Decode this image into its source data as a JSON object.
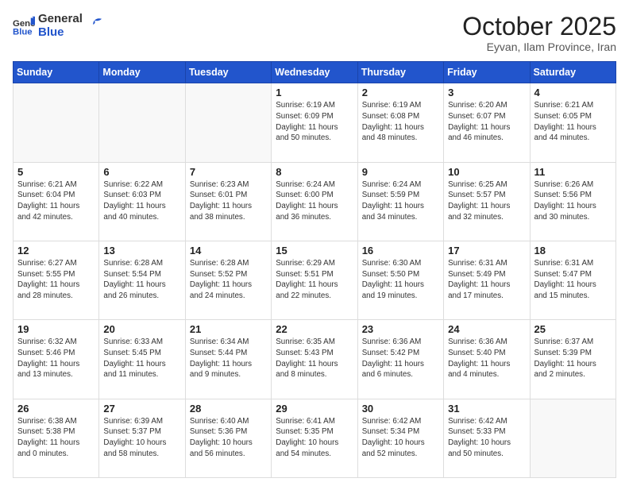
{
  "header": {
    "logo_general": "General",
    "logo_blue": "Blue",
    "month_title": "October 2025",
    "location": "Eyvan, Ilam Province, Iran"
  },
  "weekdays": [
    "Sunday",
    "Monday",
    "Tuesday",
    "Wednesday",
    "Thursday",
    "Friday",
    "Saturday"
  ],
  "weeks": [
    [
      {
        "day": "",
        "info": ""
      },
      {
        "day": "",
        "info": ""
      },
      {
        "day": "",
        "info": ""
      },
      {
        "day": "1",
        "info": "Sunrise: 6:19 AM\nSunset: 6:09 PM\nDaylight: 11 hours\nand 50 minutes."
      },
      {
        "day": "2",
        "info": "Sunrise: 6:19 AM\nSunset: 6:08 PM\nDaylight: 11 hours\nand 48 minutes."
      },
      {
        "day": "3",
        "info": "Sunrise: 6:20 AM\nSunset: 6:07 PM\nDaylight: 11 hours\nand 46 minutes."
      },
      {
        "day": "4",
        "info": "Sunrise: 6:21 AM\nSunset: 6:05 PM\nDaylight: 11 hours\nand 44 minutes."
      }
    ],
    [
      {
        "day": "5",
        "info": "Sunrise: 6:21 AM\nSunset: 6:04 PM\nDaylight: 11 hours\nand 42 minutes."
      },
      {
        "day": "6",
        "info": "Sunrise: 6:22 AM\nSunset: 6:03 PM\nDaylight: 11 hours\nand 40 minutes."
      },
      {
        "day": "7",
        "info": "Sunrise: 6:23 AM\nSunset: 6:01 PM\nDaylight: 11 hours\nand 38 minutes."
      },
      {
        "day": "8",
        "info": "Sunrise: 6:24 AM\nSunset: 6:00 PM\nDaylight: 11 hours\nand 36 minutes."
      },
      {
        "day": "9",
        "info": "Sunrise: 6:24 AM\nSunset: 5:59 PM\nDaylight: 11 hours\nand 34 minutes."
      },
      {
        "day": "10",
        "info": "Sunrise: 6:25 AM\nSunset: 5:57 PM\nDaylight: 11 hours\nand 32 minutes."
      },
      {
        "day": "11",
        "info": "Sunrise: 6:26 AM\nSunset: 5:56 PM\nDaylight: 11 hours\nand 30 minutes."
      }
    ],
    [
      {
        "day": "12",
        "info": "Sunrise: 6:27 AM\nSunset: 5:55 PM\nDaylight: 11 hours\nand 28 minutes."
      },
      {
        "day": "13",
        "info": "Sunrise: 6:28 AM\nSunset: 5:54 PM\nDaylight: 11 hours\nand 26 minutes."
      },
      {
        "day": "14",
        "info": "Sunrise: 6:28 AM\nSunset: 5:52 PM\nDaylight: 11 hours\nand 24 minutes."
      },
      {
        "day": "15",
        "info": "Sunrise: 6:29 AM\nSunset: 5:51 PM\nDaylight: 11 hours\nand 22 minutes."
      },
      {
        "day": "16",
        "info": "Sunrise: 6:30 AM\nSunset: 5:50 PM\nDaylight: 11 hours\nand 19 minutes."
      },
      {
        "day": "17",
        "info": "Sunrise: 6:31 AM\nSunset: 5:49 PM\nDaylight: 11 hours\nand 17 minutes."
      },
      {
        "day": "18",
        "info": "Sunrise: 6:31 AM\nSunset: 5:47 PM\nDaylight: 11 hours\nand 15 minutes."
      }
    ],
    [
      {
        "day": "19",
        "info": "Sunrise: 6:32 AM\nSunset: 5:46 PM\nDaylight: 11 hours\nand 13 minutes."
      },
      {
        "day": "20",
        "info": "Sunrise: 6:33 AM\nSunset: 5:45 PM\nDaylight: 11 hours\nand 11 minutes."
      },
      {
        "day": "21",
        "info": "Sunrise: 6:34 AM\nSunset: 5:44 PM\nDaylight: 11 hours\nand 9 minutes."
      },
      {
        "day": "22",
        "info": "Sunrise: 6:35 AM\nSunset: 5:43 PM\nDaylight: 11 hours\nand 8 minutes."
      },
      {
        "day": "23",
        "info": "Sunrise: 6:36 AM\nSunset: 5:42 PM\nDaylight: 11 hours\nand 6 minutes."
      },
      {
        "day": "24",
        "info": "Sunrise: 6:36 AM\nSunset: 5:40 PM\nDaylight: 11 hours\nand 4 minutes."
      },
      {
        "day": "25",
        "info": "Sunrise: 6:37 AM\nSunset: 5:39 PM\nDaylight: 11 hours\nand 2 minutes."
      }
    ],
    [
      {
        "day": "26",
        "info": "Sunrise: 6:38 AM\nSunset: 5:38 PM\nDaylight: 11 hours\nand 0 minutes."
      },
      {
        "day": "27",
        "info": "Sunrise: 6:39 AM\nSunset: 5:37 PM\nDaylight: 10 hours\nand 58 minutes."
      },
      {
        "day": "28",
        "info": "Sunrise: 6:40 AM\nSunset: 5:36 PM\nDaylight: 10 hours\nand 56 minutes."
      },
      {
        "day": "29",
        "info": "Sunrise: 6:41 AM\nSunset: 5:35 PM\nDaylight: 10 hours\nand 54 minutes."
      },
      {
        "day": "30",
        "info": "Sunrise: 6:42 AM\nSunset: 5:34 PM\nDaylight: 10 hours\nand 52 minutes."
      },
      {
        "day": "31",
        "info": "Sunrise: 6:42 AM\nSunset: 5:33 PM\nDaylight: 10 hours\nand 50 minutes."
      },
      {
        "day": "",
        "info": ""
      }
    ]
  ]
}
